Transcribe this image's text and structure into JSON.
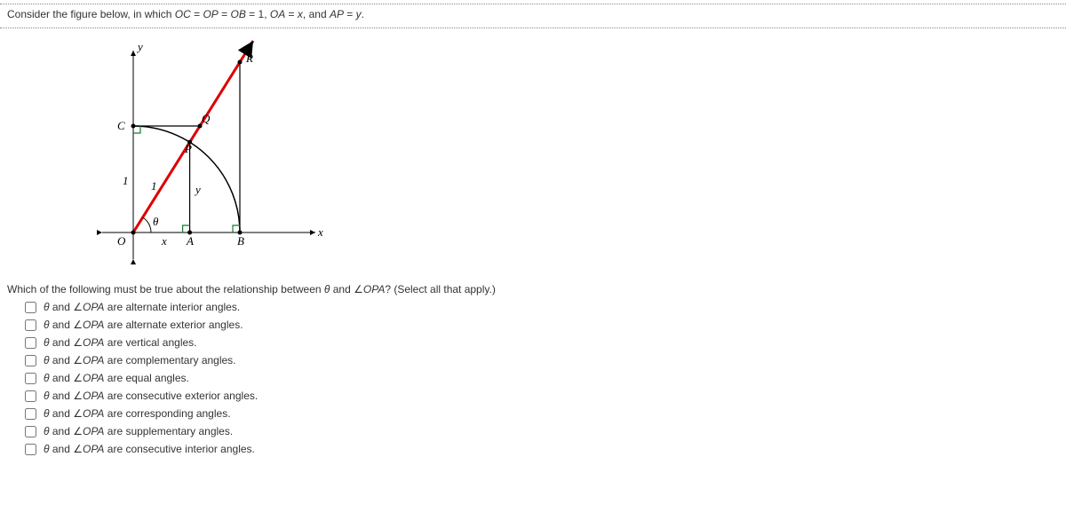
{
  "prompt": {
    "prefix": "Consider the figure below, in which ",
    "eq1_a": "OC",
    "eq1_op": " = ",
    "eq1_b": "OP",
    "eq1_op2": " = ",
    "eq1_c": "OB",
    "eq1_eq": " = 1,",
    "sp1": "   ",
    "eq2_a": "OA",
    "eq2_op": " = ",
    "eq2_b": "x",
    "eq2_c": ",",
    "sp2": "  and  ",
    "eq3_a": "AP",
    "eq3_op": " = ",
    "eq3_b": "y",
    "eq3_c": "."
  },
  "figure": {
    "labels": {
      "y_axis": "y",
      "x_axis": "x",
      "O": "O",
      "C": "C",
      "Q": "Q",
      "R": "R",
      "P": "P",
      "A": "A",
      "B": "B",
      "one_y": "1",
      "one_op": "1",
      "x_seg": "x",
      "y_seg": "y",
      "theta": "θ"
    }
  },
  "question": {
    "text_a": "Which of the following must be true about the relationship between ",
    "theta": "θ",
    "text_b": " and ",
    "angle": "∠",
    "opa": "OPA",
    "text_c": "? (Select all that apply.)"
  },
  "choices": [
    {
      "theta": "θ",
      "mid": " and ",
      "ang": "∠",
      "opa": "OPA",
      "rest": " are alternate interior angles."
    },
    {
      "theta": "θ",
      "mid": " and ",
      "ang": "∠",
      "opa": "OPA",
      "rest": " are alternate exterior angles."
    },
    {
      "theta": "θ",
      "mid": " and ",
      "ang": "∠",
      "opa": "OPA",
      "rest": " are vertical angles."
    },
    {
      "theta": "θ",
      "mid": " and ",
      "ang": "∠",
      "opa": "OPA",
      "rest": " are complementary angles."
    },
    {
      "theta": "θ",
      "mid": " and ",
      "ang": "∠",
      "opa": "OPA",
      "rest": " are equal angles."
    },
    {
      "theta": "θ",
      "mid": " and ",
      "ang": "∠",
      "opa": "OPA",
      "rest": " are consecutive exterior angles."
    },
    {
      "theta": "θ",
      "mid": " and ",
      "ang": "∠",
      "opa": "OPA",
      "rest": " are corresponding angles."
    },
    {
      "theta": "θ",
      "mid": " and ",
      "ang": "∠",
      "opa": "OPA",
      "rest": " are supplementary angles."
    },
    {
      "theta": "θ",
      "mid": " and ",
      "ang": "∠",
      "opa": "OPA",
      "rest": " are consecutive interior angles."
    }
  ]
}
